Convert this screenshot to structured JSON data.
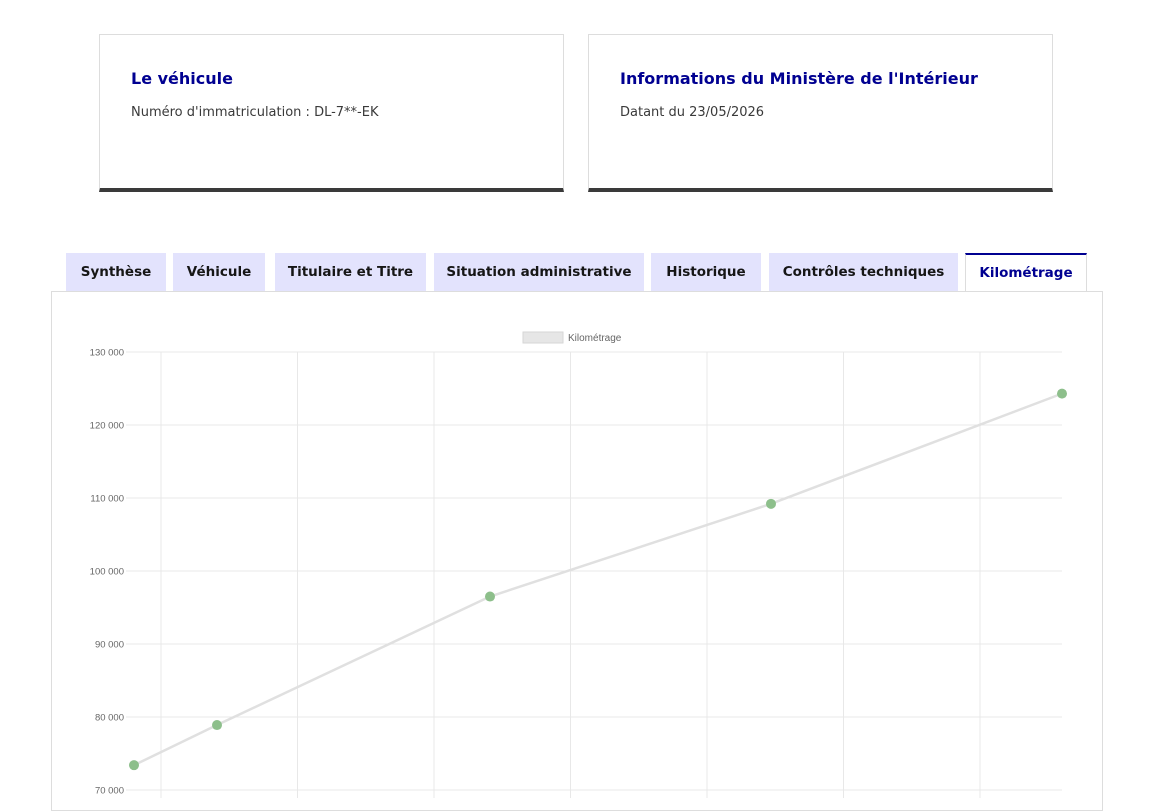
{
  "vehicle_card": {
    "title": "Le véhicule",
    "registration": "Numéro d'immatriculation : DL-7**-EK"
  },
  "ministry_card": {
    "title": "Informations du Ministère de l'Intérieur",
    "date": "Datant du 23/05/2026"
  },
  "tabs": [
    {
      "label": "Synthèse",
      "active": false
    },
    {
      "label": "Véhicule",
      "active": false
    },
    {
      "label": "Titulaire et Titre",
      "active": false
    },
    {
      "label": "Situation administrative",
      "active": false
    },
    {
      "label": "Historique",
      "active": false
    },
    {
      "label": "Contrôles techniques",
      "active": false
    },
    {
      "label": "Kilométrage",
      "active": true
    }
  ],
  "colors": {
    "accent": "#000091",
    "tab_bg": "#e3e3fd",
    "line": "#e0e0e0",
    "point": "#8dbf8b"
  },
  "chart_data": {
    "type": "line",
    "legend": {
      "label": "Kilométrage",
      "position": "top"
    },
    "ylim": [
      70000,
      130000
    ],
    "y_ticks": [
      "130 000",
      "120 000",
      "110 000",
      "100 000",
      "90 000",
      "80 000",
      "70 000"
    ],
    "grid": true,
    "series": [
      {
        "name": "Kilométrage",
        "values": [
          73400,
          78900,
          96500,
          109200,
          124300
        ]
      }
    ]
  }
}
